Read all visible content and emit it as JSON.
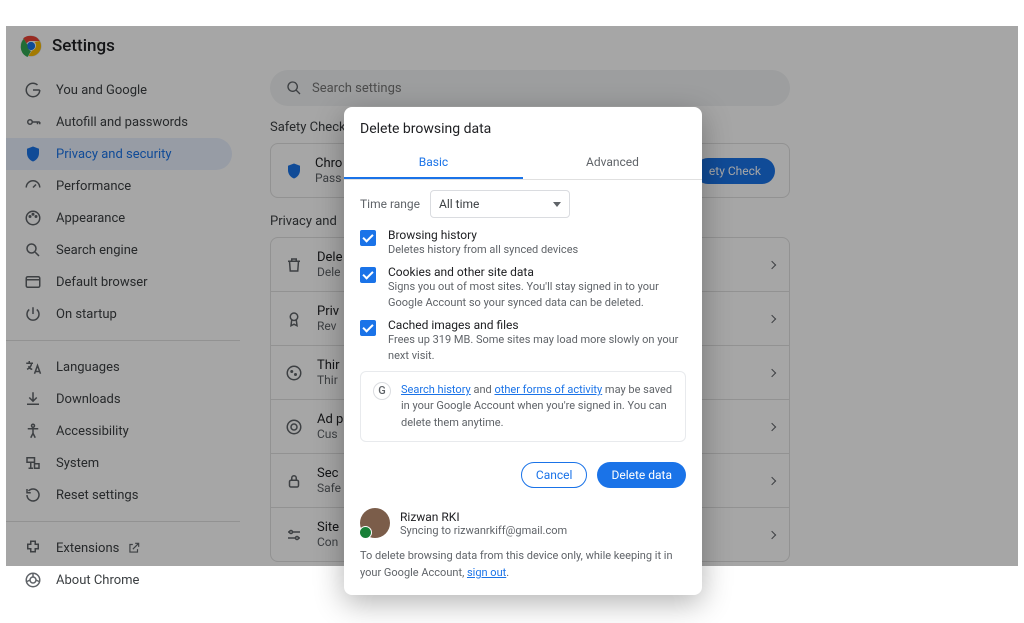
{
  "settings_title": "Settings",
  "search_placeholder": "Search settings",
  "sidebar": {
    "items": [
      {
        "label": "You and Google"
      },
      {
        "label": "Autofill and passwords"
      },
      {
        "label": "Privacy and security"
      },
      {
        "label": "Performance"
      },
      {
        "label": "Appearance"
      },
      {
        "label": "Search engine"
      },
      {
        "label": "Default browser"
      },
      {
        "label": "On startup"
      }
    ],
    "secondary": [
      {
        "label": "Languages"
      },
      {
        "label": "Downloads"
      },
      {
        "label": "Accessibility"
      },
      {
        "label": "System"
      },
      {
        "label": "Reset settings"
      }
    ],
    "footer": [
      {
        "label": "Extensions"
      },
      {
        "label": "About Chrome"
      }
    ]
  },
  "safety": {
    "section": "Safety Check",
    "title": "Chro",
    "sub": "Pass",
    "button": "ety Check"
  },
  "privacy_section": "Privacy and",
  "rows": [
    {
      "title": "Dele",
      "sub": "Dele"
    },
    {
      "title": "Priv",
      "sub": "Rev"
    },
    {
      "title": "Thir",
      "sub": "Thir"
    },
    {
      "title": "Ad p",
      "sub": "Cus"
    },
    {
      "title": "Sec",
      "sub": "Safe"
    },
    {
      "title": "Site",
      "sub": "Con"
    }
  ],
  "dialog": {
    "title": "Delete browsing data",
    "tab_basic": "Basic",
    "tab_advanced": "Advanced",
    "time_label": "Time range",
    "time_value": "All time",
    "items": [
      {
        "title": "Browsing history",
        "desc": "Deletes history from all synced devices"
      },
      {
        "title": "Cookies and other site data",
        "desc": "Signs you out of most sites. You'll stay signed in to your Google Account so your synced data can be deleted."
      },
      {
        "title": "Cached images and files",
        "desc": "Frees up 319 MB. Some sites may load more slowly on your next visit."
      }
    ],
    "info_link1": "Search history",
    "info_conj": " and ",
    "info_link2": "other forms of activity",
    "info_rest": " may be saved in your Google Account when you're signed in. You can delete them anytime.",
    "cancel": "Cancel",
    "delete": "Delete data",
    "account_name": "Rizwan RKI",
    "account_sync": "Syncing to rizwanrkiff@gmail.com",
    "footer_text": "To delete browsing data from this device only, while keeping it in your Google Account, ",
    "footer_link": "sign out",
    "footer_period": "."
  }
}
